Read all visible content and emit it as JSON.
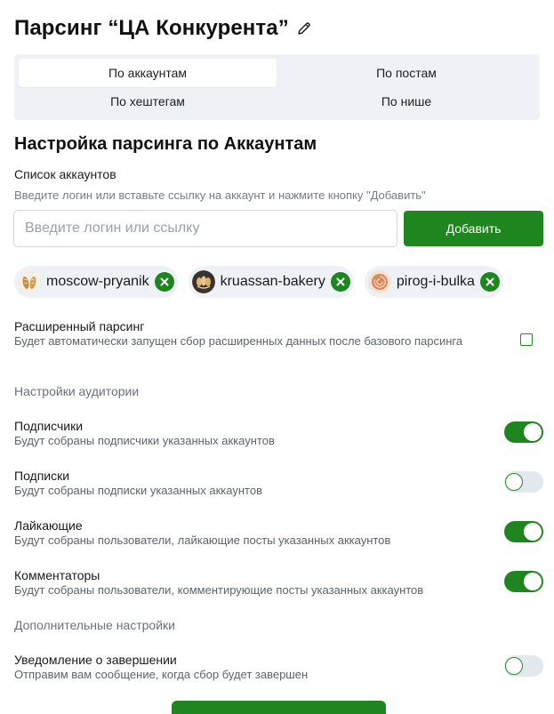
{
  "page": {
    "title": "Парсинг “ЦА Конкурента”"
  },
  "tabs": [
    {
      "label": "По аккаунтам",
      "active": true
    },
    {
      "label": "По постам",
      "active": false
    },
    {
      "label": "По хештегам",
      "active": false
    },
    {
      "label": "По нише",
      "active": false
    }
  ],
  "section": {
    "title": "Настройка парсинга по Аккаунтам",
    "list_label": "Список аккаунтов",
    "hint": "Введите логин или вставьте ссылку на аккаунт и нажмите кнопку \"Добавить\"",
    "input_placeholder": "Введите логин или ссылку",
    "add_button": "Добавить"
  },
  "accounts": [
    {
      "name": "moscow-pryanik"
    },
    {
      "name": "kruassan-bakery"
    },
    {
      "name": "pirog-i-bulka"
    }
  ],
  "extended": {
    "title": "Расширенный парсинг",
    "description": "Будет автоматически запущен сбор расширенных данных после базового парсинга",
    "checked": false
  },
  "audience": {
    "label": "Настройки аудитории",
    "options": [
      {
        "title": "Подписчики",
        "description": "Будут собраны подписчики указанных аккаунтов",
        "enabled": true
      },
      {
        "title": "Подписки",
        "description": "Будут собраны подписки указанных аккаунтов",
        "enabled": false
      },
      {
        "title": "Лайкающие",
        "description": "Будут собраны пользователи, лайкающие посты указанных аккаунтов",
        "enabled": true
      },
      {
        "title": "Комментаторы",
        "description": "Будут собраны пользователи, комментирующие посты указанных аккаунтов",
        "enabled": true
      }
    ]
  },
  "additional": {
    "label": "Дополнительные настройки",
    "notification": {
      "title": "Уведомление о завершении",
      "description": "Отправим вам сообщение, когда сбор будет завершен",
      "enabled": false
    }
  },
  "colors": {
    "accent": "#1f861f",
    "segment_bg": "#eef2f6",
    "toggle_off": "#e3e8ee"
  }
}
